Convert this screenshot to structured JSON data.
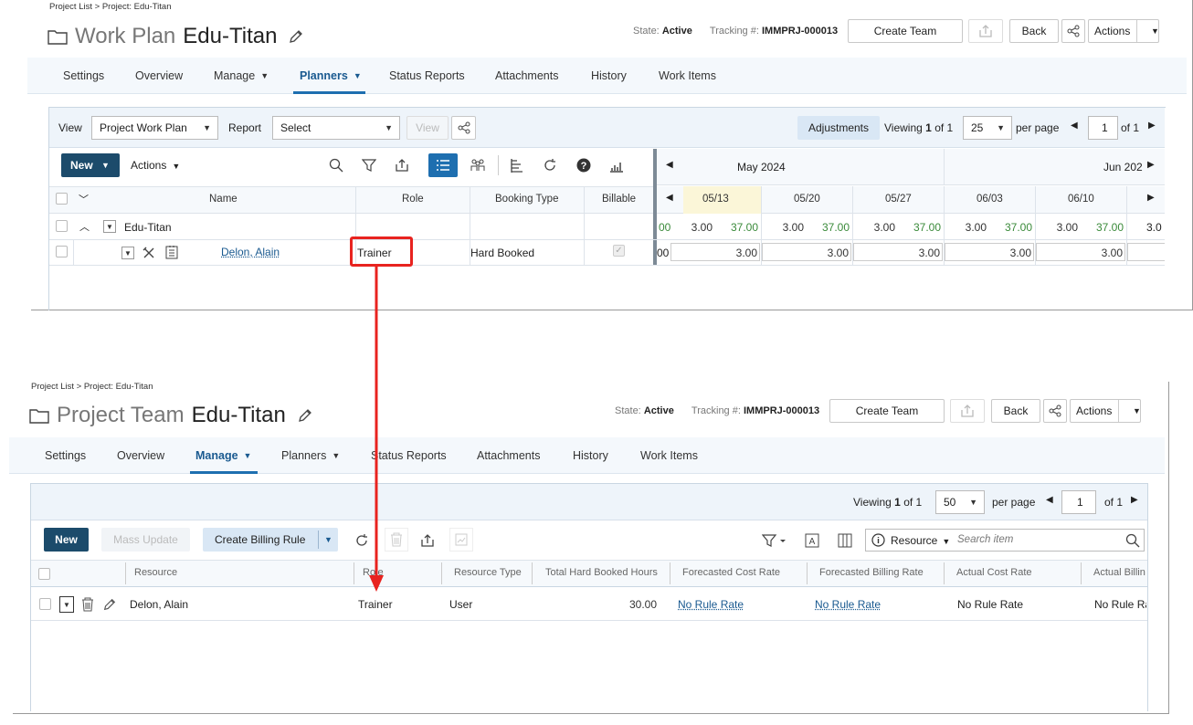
{
  "top": {
    "breadcrumb": "Project List > Project: Edu-Titan",
    "title_label": "Work Plan",
    "project_name": "Edu-Titan",
    "state_label": "State:",
    "state_value": "Active",
    "tracking_label": "Tracking #:",
    "tracking_value": "IMMPRJ-000013",
    "create_team": "Create Team",
    "back": "Back",
    "actions": "Actions",
    "tabs": [
      "Settings",
      "Overview",
      "Manage",
      "Planners",
      "Status Reports",
      "Attachments",
      "History",
      "Work Items"
    ],
    "toolbar": {
      "view_label": "View",
      "view_value": "Project Work Plan",
      "report_label": "Report",
      "report_value": "Select",
      "view_btn": "View",
      "adjustments": "Adjustments",
      "viewing_prefix": "Viewing",
      "viewing_page": "1",
      "viewing_of": "of 1",
      "per_page_value": "25",
      "per_page_label": "per page",
      "page_input": "1",
      "page_of": "of 1"
    },
    "new_btn": "New",
    "actions_btn": "Actions",
    "columns": [
      "Name",
      "Role",
      "Booking Type",
      "Billable"
    ],
    "months": [
      "May 2024",
      "Jun 202"
    ],
    "weeks": [
      "05/13",
      "05/20",
      "05/27",
      "06/03",
      "06/10"
    ],
    "row_project": "Edu-Titan",
    "row_project_partial": "00",
    "row_project_weeks": [
      [
        "3.00",
        "37.00"
      ],
      [
        "3.00",
        "37.00"
      ],
      [
        "3.00",
        "37.00"
      ],
      [
        "3.00",
        "37.00"
      ],
      [
        "3.00",
        "37.00"
      ]
    ],
    "row_project_last": "3.0",
    "row_person": "Delon, Alain",
    "row_role": "Trainer",
    "row_booking": "Hard Booked",
    "row_person_partial": "00",
    "row_person_weeks": [
      "3.00",
      "3.00",
      "3.00",
      "3.00",
      "3.00"
    ]
  },
  "bottom": {
    "breadcrumb": "Project List > Project: Edu-Titan",
    "title_label": "Project Team",
    "project_name": "Edu-Titan",
    "state_label": "State:",
    "state_value": "Active",
    "tracking_label": "Tracking #:",
    "tracking_value": "IMMPRJ-000013",
    "create_team": "Create Team",
    "back": "Back",
    "actions": "Actions",
    "tabs": [
      "Settings",
      "Overview",
      "Manage",
      "Planners",
      "Status Reports",
      "Attachments",
      "History",
      "Work Items"
    ],
    "viewing_prefix": "Viewing",
    "viewing_page": "1",
    "viewing_of": "of 1",
    "per_page_value": "50",
    "per_page_label": "per page",
    "page_input": "1",
    "page_of": "of 1",
    "new_btn": "New",
    "mass_update": "Mass Update",
    "create_billing_rule": "Create Billing Rule",
    "resource_filter": "Resource",
    "search_placeholder": "Search item",
    "columns": [
      "Resource",
      "Role",
      "Resource Type",
      "Total Hard Booked Hours",
      "Forecasted Cost Rate",
      "Forecasted Billing Rate",
      "Actual Cost Rate",
      "Actual Billin"
    ],
    "row": {
      "resource": "Delon, Alain",
      "role": "Trainer",
      "type": "User",
      "hours": "30.00",
      "fcr": "No Rule Rate",
      "fbr": "No Rule Rate",
      "acr": "No Rule Rate",
      "abr": "No Rule Ra"
    }
  },
  "colors": {
    "accent": "#1e6fb0",
    "dark_button": "#1c4b6b",
    "highlight": "#e8231f",
    "green_value": "#3a8a3a"
  }
}
